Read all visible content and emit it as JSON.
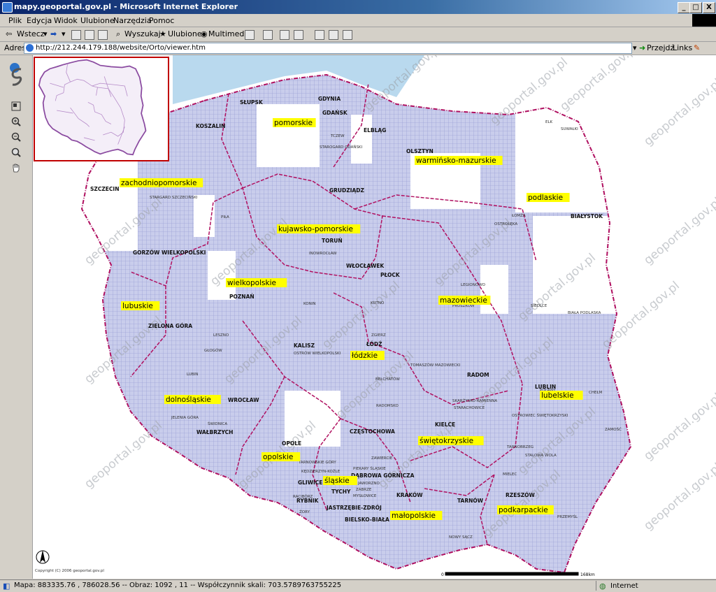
{
  "window": {
    "title": "mapy.geoportal.gov.pl - Microsoft Internet Explorer",
    "buttons": [
      "_",
      "□",
      "X"
    ]
  },
  "menu": [
    "Plik",
    "Edycja",
    "Widok",
    "Ulubione",
    "Narzędzia",
    "Pomoc"
  ],
  "toolbar": {
    "back": "Wstecz",
    "search": "Wyszukaj",
    "favorites": "Ulubione",
    "multimedia": "Multimedia"
  },
  "address": {
    "label": "Adres",
    "url": "http://212.244.179.188/website/Orto/viewer.htm",
    "go": "Przejdź",
    "links": "Links"
  },
  "map": {
    "voivodeships": [
      {
        "id": "zachodniopomorskie",
        "label": "zachodniopomorskie"
      },
      {
        "id": "pomorskie",
        "label": "pomorskie"
      },
      {
        "id": "warminsko",
        "label": "warmińsko-mazurskie"
      },
      {
        "id": "podlaskie",
        "label": "podlaskie"
      },
      {
        "id": "kujawsko",
        "label": "kujawsko-pomorskie"
      },
      {
        "id": "wielkopolskie",
        "label": "wielkopolskie"
      },
      {
        "id": "mazowieckie",
        "label": "mazowieckie"
      },
      {
        "id": "lubuskie",
        "label": "lubuskie"
      },
      {
        "id": "lodzkie",
        "label": "łódzkie"
      },
      {
        "id": "lubelskie",
        "label": "lubelskie"
      },
      {
        "id": "dolnoslaskie",
        "label": "dolnośląskie"
      },
      {
        "id": "opolskie",
        "label": "opolskie"
      },
      {
        "id": "swietokrzyskie",
        "label": "świętokrzyskie"
      },
      {
        "id": "slaskie",
        "label": "śląskie"
      },
      {
        "id": "malopolskie",
        "label": "małopolskie"
      },
      {
        "id": "podkarpackie",
        "label": "podkarpackie"
      }
    ],
    "cities_major": [
      "SŁUPSK",
      "GDYNIA",
      "GDAŃSK",
      "KOSZALIN",
      "ELBLĄG",
      "OLSZTYN",
      "SZCZECIN",
      "GRUDZIĄDZ",
      "BIAŁYSTOK",
      "TORUŃ",
      "GORZÓW WIELKOPOLSKI",
      "WŁOCŁAWEK",
      "PŁOCK",
      "POZNAŃ",
      "ZIELONA GÓRA",
      "KALISZ",
      "ŁÓDŹ",
      "RADOM",
      "LUBLIN",
      "WROCŁAW",
      "KIELCE",
      "WAŁBRZYCH",
      "OPOLE",
      "CZĘSTOCHOWA",
      "DĄBROWA GÓRNICZA",
      "GLIWICE",
      "TYCHY",
      "RYBNIK",
      "KRAKÓW",
      "TARNÓW",
      "RZESZÓW",
      "JASTRZĘBIE-ZDRÓJ",
      "BIELSKO-BIAŁA"
    ],
    "cities_minor": [
      "TCZEW",
      "STAROGARD GDAŃSKI",
      "ELK",
      "SUWAŁKI",
      "STARGARD SZCZECIŃSKI",
      "PIŁA",
      "ŁOMŻA",
      "OSTROŁĘKA",
      "INOWROCŁAW",
      "LEGIONOWO",
      "PRUSZKÓW",
      "SIEDLCE",
      "BIAŁA PODLASKA",
      "KONIN",
      "LESZNO",
      "GŁOGÓW",
      "OSTRÓW WIELKOPOLSKI",
      "ZGIERZ",
      "KUTNO",
      "TOMASZÓW MAZOWIECKI",
      "BEŁCHATÓW",
      "PUŁAWY",
      "LUBIN",
      "CHEŁM",
      "SKARŻYSKO-KAMIENNA",
      "STARACHOWICE",
      "OSTROWIEC ŚWIĘTOKRZYSKI",
      "RADOMSKO",
      "JELENIA GÓRA",
      "ŚWIDNICA",
      "ZAMOŚĆ",
      "TARNOBRZEG",
      "STALOWA WOLA",
      "ZAWIERCIE",
      "TARNOWSKIE GÓRY",
      "PIEKARY ŚLĄSKIE",
      "KĘDZIERZYN-KOŹLE",
      "JAWORZNO",
      "ZABRZE",
      "MYSŁOWICE",
      "RACIBÓRZ",
      "ŻORY",
      "MIELEC",
      "PRZEMYŚL",
      "NOWY SĄCZ"
    ],
    "watermark": "geoportal.gov.pl",
    "scale_label": "168km",
    "scale_zero": "0",
    "copyright": "Copyright (C) 2006 geoportal.gov.pl",
    "north": "N"
  },
  "status": {
    "text": "Mapa: 883335.76 , 786028.56 -- Obraz: 1092 , 11 -- Współczynnik skali: 703.5789763755225",
    "zone": "Internet"
  }
}
